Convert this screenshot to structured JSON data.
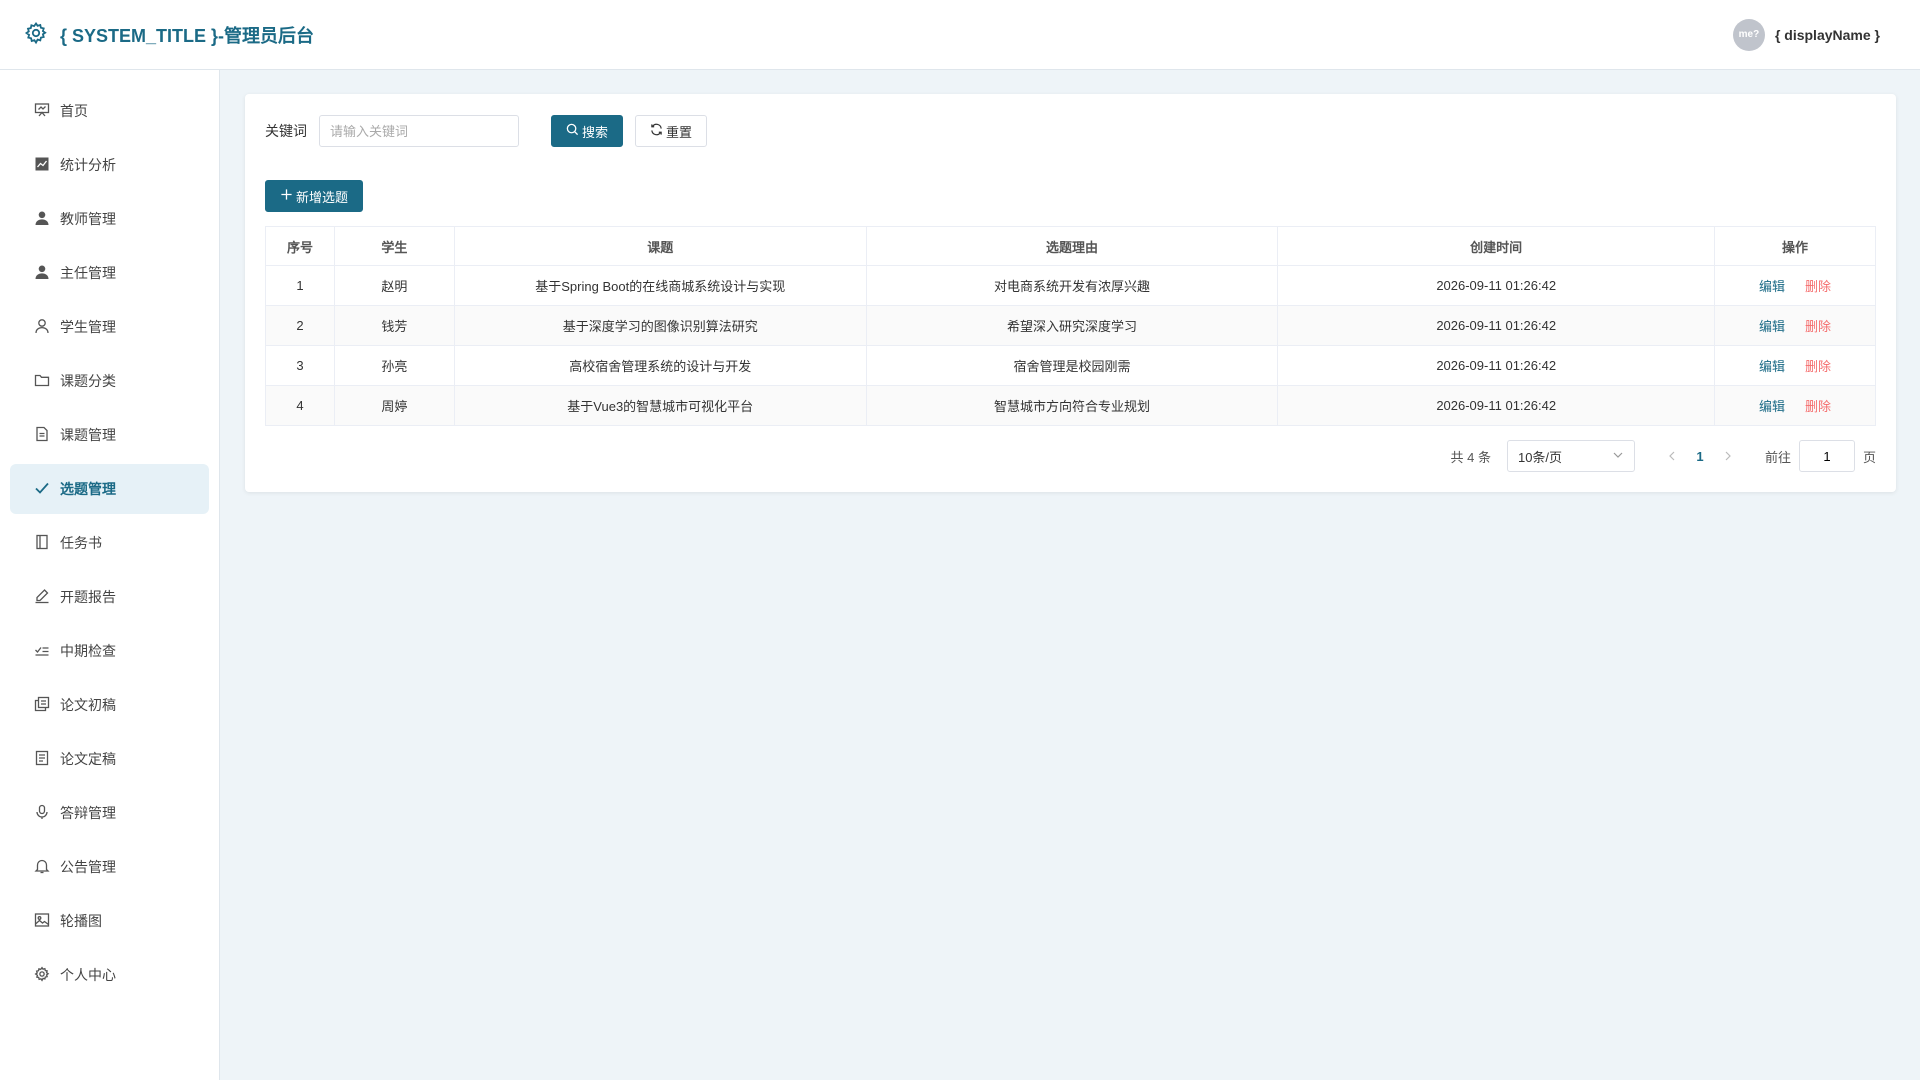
{
  "header": {
    "title": "{ SYSTEM_TITLE }-管理员后台",
    "avatar_text": "me?",
    "display_name": "{ displayName }"
  },
  "sidebar": {
    "items": [
      {
        "label": "首页",
        "icon": "presentation-icon"
      },
      {
        "label": "统计分析",
        "icon": "chart-icon"
      },
      {
        "label": "教师管理",
        "icon": "user-filled-icon"
      },
      {
        "label": "主任管理",
        "icon": "user-filled-icon"
      },
      {
        "label": "学生管理",
        "icon": "user-outline-icon"
      },
      {
        "label": "课题分类",
        "icon": "folder-icon"
      },
      {
        "label": "课题管理",
        "icon": "document-icon"
      },
      {
        "label": "选题管理",
        "icon": "check-icon",
        "active": true
      },
      {
        "label": "任务书",
        "icon": "notebook-icon"
      },
      {
        "label": "开题报告",
        "icon": "edit-pen-icon"
      },
      {
        "label": "中期检查",
        "icon": "checklist-icon"
      },
      {
        "label": "论文初稿",
        "icon": "copy-document-icon"
      },
      {
        "label": "论文定稿",
        "icon": "tickets-icon"
      },
      {
        "label": "答辩管理",
        "icon": "microphone-icon"
      },
      {
        "label": "公告管理",
        "icon": "bell-icon"
      },
      {
        "label": "轮播图",
        "icon": "picture-icon"
      },
      {
        "label": "个人中心",
        "icon": "gear-icon"
      }
    ]
  },
  "search": {
    "label": "关键词",
    "placeholder": "请输入关键词",
    "value": "",
    "search_label": "搜索",
    "reset_label": "重置"
  },
  "toolbar": {
    "add_label": "新增选题"
  },
  "table": {
    "columns": [
      "序号",
      "学生",
      "课题",
      "选题理由",
      "创建时间",
      "操作"
    ],
    "edit_label": "编辑",
    "delete_label": "删除",
    "rows": [
      {
        "no": "1",
        "student": "赵明",
        "topic": "基于Spring Boot的在线商城系统设计与实现",
        "reason": "对电商系统开发有浓厚兴趣",
        "created": "2026-09-11 01:26:42"
      },
      {
        "no": "2",
        "student": "钱芳",
        "topic": "基于深度学习的图像识别算法研究",
        "reason": "希望深入研究深度学习",
        "created": "2026-09-11 01:26:42"
      },
      {
        "no": "3",
        "student": "孙亮",
        "topic": "高校宿舍管理系统的设计与开发",
        "reason": "宿舍管理是校园刚需",
        "created": "2026-09-11 01:26:42"
      },
      {
        "no": "4",
        "student": "周婷",
        "topic": "基于Vue3的智慧城市可视化平台",
        "reason": "智慧城市方向符合专业规划",
        "created": "2026-09-11 01:26:42"
      }
    ]
  },
  "pagination": {
    "total_text": "共 4 条",
    "page_size": "10条/页",
    "current_page": "1",
    "goto_label": "前往",
    "goto_value": "1",
    "goto_suffix": "页"
  },
  "colors": {
    "accent": "#1b6a86",
    "danger": "#f56c6c",
    "background": "#eef4f8"
  }
}
